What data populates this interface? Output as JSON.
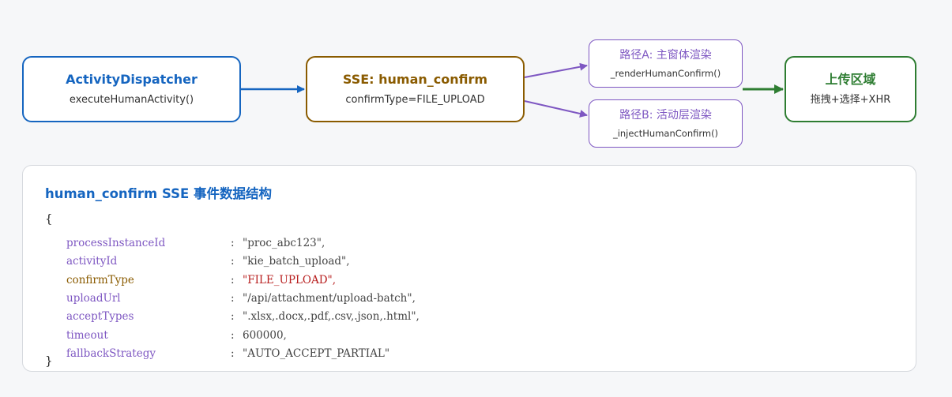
{
  "nodes": {
    "dispatcher": {
      "title": "ActivityDispatcher",
      "subtitle": "executeHumanActivity()"
    },
    "sse": {
      "title": "SSE: human_confirm",
      "subtitle": "confirmType=FILE_UPLOAD"
    },
    "path_a": {
      "title": "路径A: 主窗体渲染",
      "subtitle": "_renderHumanConfirm()"
    },
    "path_b": {
      "title": "路径B: 活动层渲染",
      "subtitle": "_injectHumanConfirm()"
    },
    "upload": {
      "title": "上传区域",
      "subtitle": "拖拽+选择+XHR"
    }
  },
  "card": {
    "title": "human_confirm SSE 事件数据结构",
    "open_brace": "{",
    "close_brace": "}",
    "fields": [
      {
        "key": "processInstanceId",
        "value": "\"proc_abc123\","
      },
      {
        "key": "activityId",
        "value": "\"kie_batch_upload\","
      },
      {
        "key": "confirmType",
        "value": "\"FILE_UPLOAD\","
      },
      {
        "key": "uploadUrl",
        "value": "\"/api/attachment/upload-batch\","
      },
      {
        "key": "acceptTypes",
        "value": "\".xlsx,.docx,.pdf,.csv,.json,.html\","
      },
      {
        "key": "timeout",
        "value": "600000,"
      },
      {
        "key": "fallbackStrategy",
        "value": "\"AUTO_ACCEPT_PARTIAL\""
      }
    ],
    "colon": ":"
  },
  "colors": {
    "blue": "#1565c0",
    "brown": "#8a5b00",
    "purple": "#7e57c2",
    "green": "#2e7d32",
    "highlight_value": "#b71c1c"
  }
}
